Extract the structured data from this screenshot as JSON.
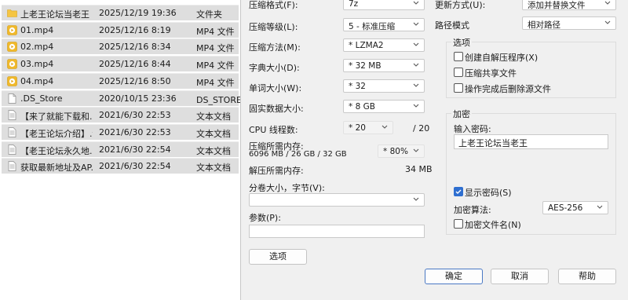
{
  "files": [
    {
      "icon": "folder-icon",
      "name": "上老王论坛当老王",
      "date": "2025/12/19 19:36",
      "type": "文件夹"
    },
    {
      "icon": "mp4-file-icon",
      "name": "01.mp4",
      "date": "2025/12/16 8:19",
      "type": "MP4 文件"
    },
    {
      "icon": "mp4-file-icon",
      "name": "02.mp4",
      "date": "2025/12/16 8:34",
      "type": "MP4 文件"
    },
    {
      "icon": "mp4-file-icon",
      "name": "03.mp4",
      "date": "2025/12/16 8:44",
      "type": "MP4 文件"
    },
    {
      "icon": "mp4-file-icon",
      "name": "04.mp4",
      "date": "2025/12/16 8:50",
      "type": "MP4 文件"
    },
    {
      "icon": "blank-file-icon",
      "name": ".DS_Store",
      "date": "2020/10/15 23:36",
      "type": "DS_STORE 文件"
    },
    {
      "icon": "text-file-icon",
      "name": "【来了就能下载和...",
      "date": "2021/6/30 22:53",
      "type": "文本文档"
    },
    {
      "icon": "text-file-icon",
      "name": "【老王论坛介绍】.txt",
      "date": "2021/6/30 22:53",
      "type": "文本文档"
    },
    {
      "icon": "text-file-icon",
      "name": "【老王论坛永久地...",
      "date": "2021/6/30 22:54",
      "type": "文本文档"
    },
    {
      "icon": "text-file-icon",
      "name": "获取最新地址及AP...",
      "date": "2021/6/30 22:54",
      "type": "文本文档"
    }
  ],
  "dialog": {
    "format_label": "压缩格式(F):",
    "format_value": "7z",
    "level_label": "压缩等级(L):",
    "level_value": "5 - 标准压缩",
    "method_label": "压缩方法(M):",
    "method_value": "* LZMA2",
    "dict_label": "字典大小(D):",
    "dict_value": "* 32 MB",
    "word_label": "单词大小(W):",
    "word_value": "* 32",
    "solid_label": "固实数据大小:",
    "solid_value": "* 8 GB",
    "cpu_label": "CPU 线程数:",
    "cpu_value": "* 20",
    "cpu_max": "/ 20",
    "mem_compress_label": "压缩所需内存:",
    "mem_compress_detail": "6096 MB / 26 GB / 32 GB",
    "mem_percent": "* 80%",
    "mem_decompress_label": "解压所需内存:",
    "mem_decompress_value": "34 MB",
    "split_label": "分卷大小，字节(V):",
    "split_value": "",
    "params_label": "参数(P):",
    "params_value": "",
    "options_button": "选项",
    "update_label": "更新方式(U):",
    "update_value": "添加并替换文件",
    "path_label": "路径模式",
    "path_value": "相对路径",
    "options_group_title": "选项",
    "sfx_label": "创建自解压程序(X)",
    "sfx_checked": false,
    "shared_label": "压缩共享文件",
    "shared_checked": false,
    "delete_label": "操作完成后删除源文件",
    "delete_checked": false,
    "encrypt_group_title": "加密",
    "password_label": "输入密码:",
    "password_value": "上老王论坛当老王",
    "show_password_label": "显示密码(S)",
    "show_password_checked": true,
    "enc_method_label": "加密算法:",
    "enc_method_value": "AES-256",
    "enc_names_label": "加密文件名(N)",
    "enc_names_checked": false,
    "ok_button": "确定",
    "cancel_button": "取消",
    "help_button": "帮助"
  }
}
